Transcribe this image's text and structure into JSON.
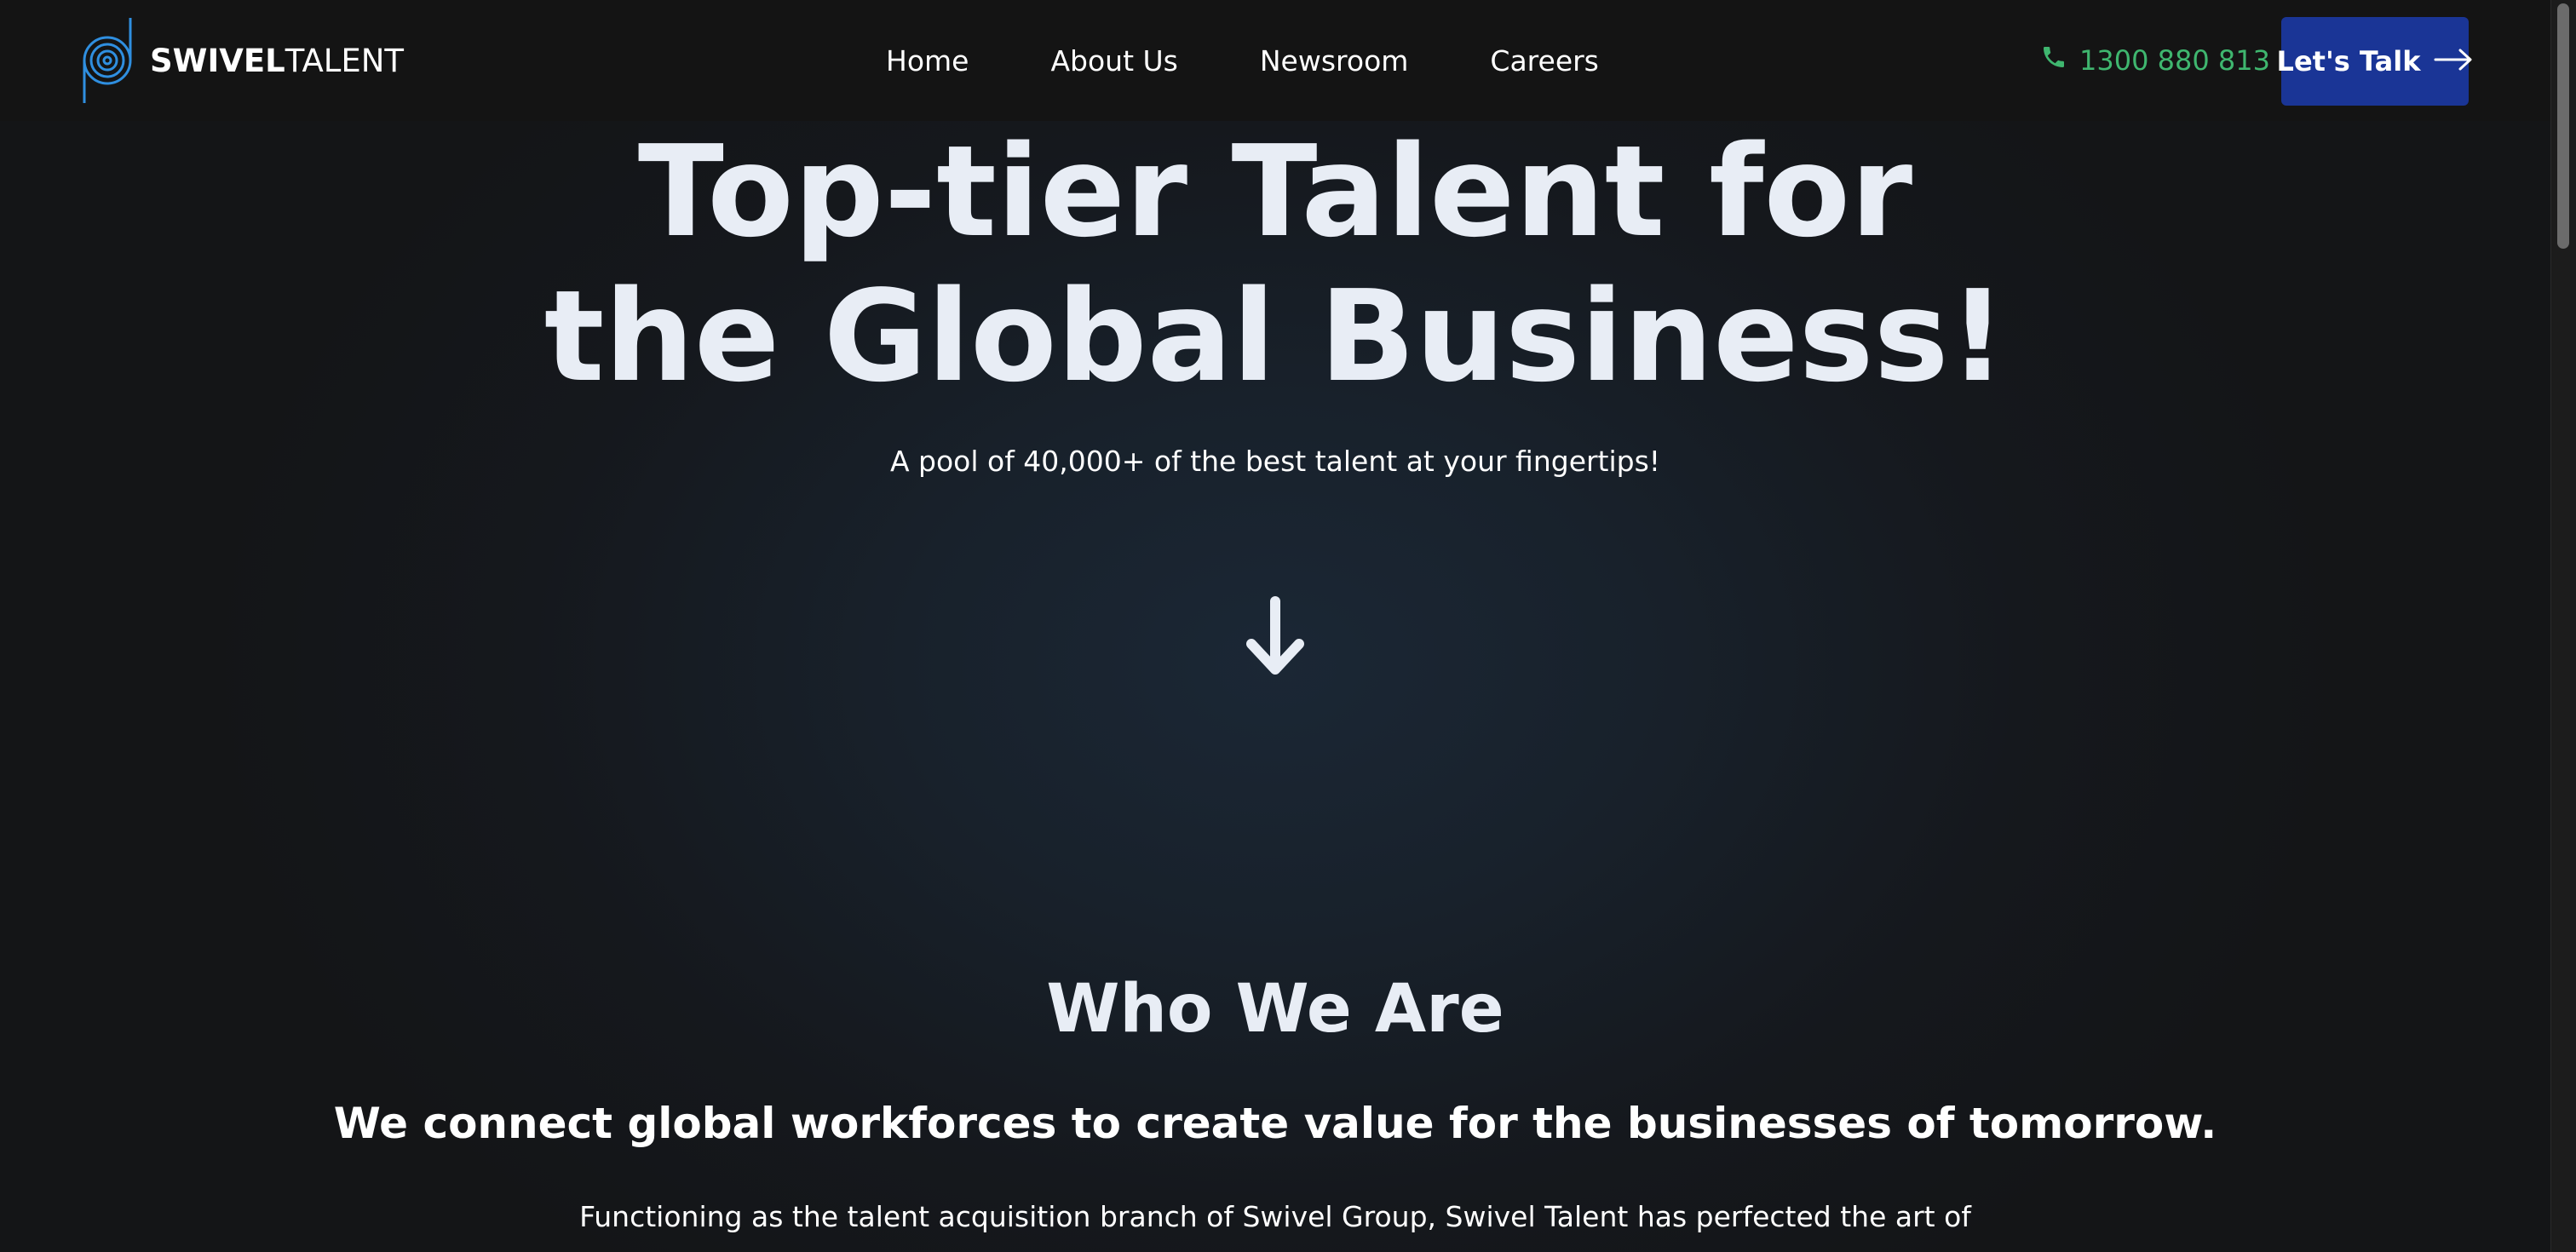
{
  "header": {
    "logo": {
      "brand_bold": "SWIVEL",
      "brand_light": "TALENT",
      "icon": "swivel-spiral-logo-icon"
    },
    "nav": [
      {
        "label": "Home"
      },
      {
        "label": "About Us"
      },
      {
        "label": "Newsroom"
      },
      {
        "label": "Careers"
      }
    ],
    "phone": {
      "icon": "phone-icon",
      "number": "1300 880 813"
    },
    "cta": {
      "label": "Let's Talk",
      "icon": "arrow-right-icon"
    }
  },
  "hero": {
    "title_line1": "Top-tier Talent for",
    "title_line2": "the Global Business!",
    "subtitle": "A pool of 40,000+ of the best talent at your fingertips!",
    "scroll_icon": "arrow-down-icon"
  },
  "who_we_are": {
    "title": "Who We Are",
    "lead": "We connect global workforces to create value for the businesses of tomorrow.",
    "body_line1": "Functioning as the talent acquisition branch of Swivel Group, Swivel Talent has perfected the art of"
  },
  "colors": {
    "header_bg": "#141414",
    "page_bg": "#141517",
    "accent_blue": "#1a3596",
    "phone_green": "#3fb66f",
    "heading_text": "#e8edf5",
    "logo_blue": "#2f8fe0"
  }
}
